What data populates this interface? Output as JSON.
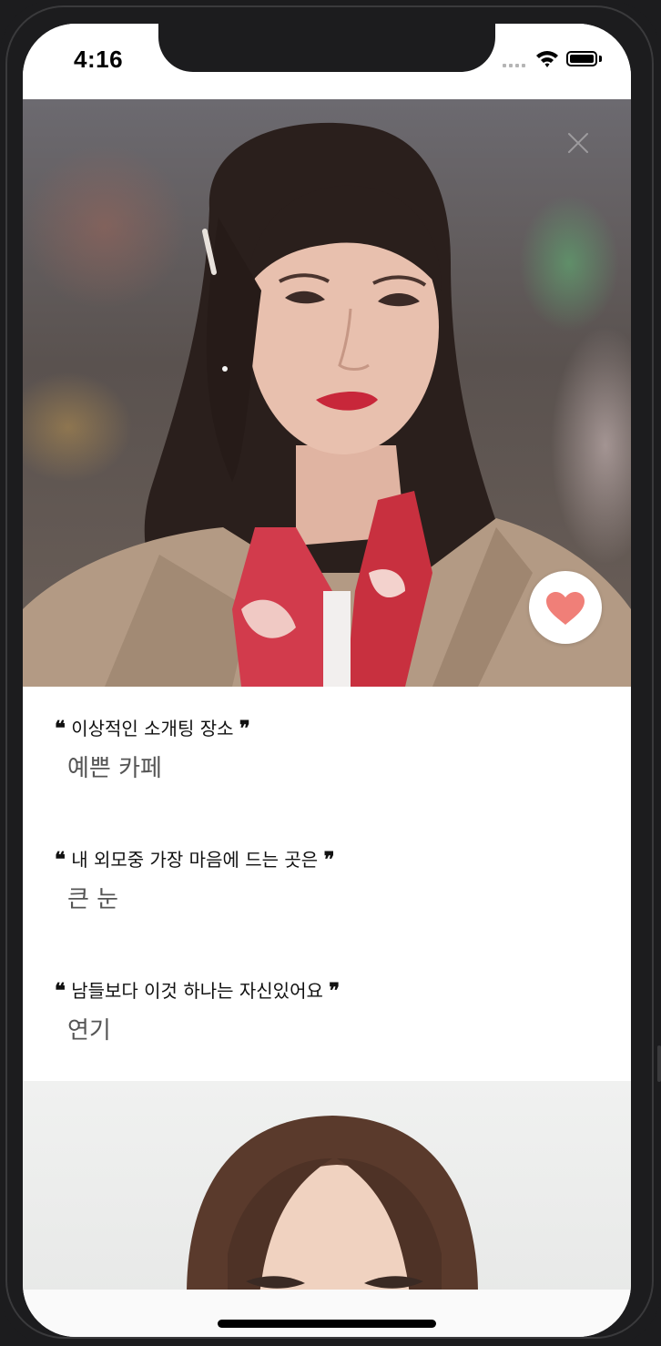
{
  "status_bar": {
    "time": "4:16"
  },
  "profile": {
    "qa": [
      {
        "question": "이상적인 소개팅 장소",
        "answer": "예쁜 카페"
      },
      {
        "question": "내 외모중 가장 마음에 드는 곳은",
        "answer": "큰 눈"
      },
      {
        "question": "남들보다 이것 하나는 자신있어요",
        "answer": "연기"
      }
    ],
    "quote_open": "❝",
    "quote_close": "❞"
  },
  "colors": {
    "like_heart": "#f07f78",
    "answer_text": "#555555"
  },
  "icons": {
    "close": "close-icon",
    "like": "heart-icon",
    "wifi": "wifi-icon",
    "battery": "battery-icon",
    "signal": "cellular-signal-icon"
  }
}
